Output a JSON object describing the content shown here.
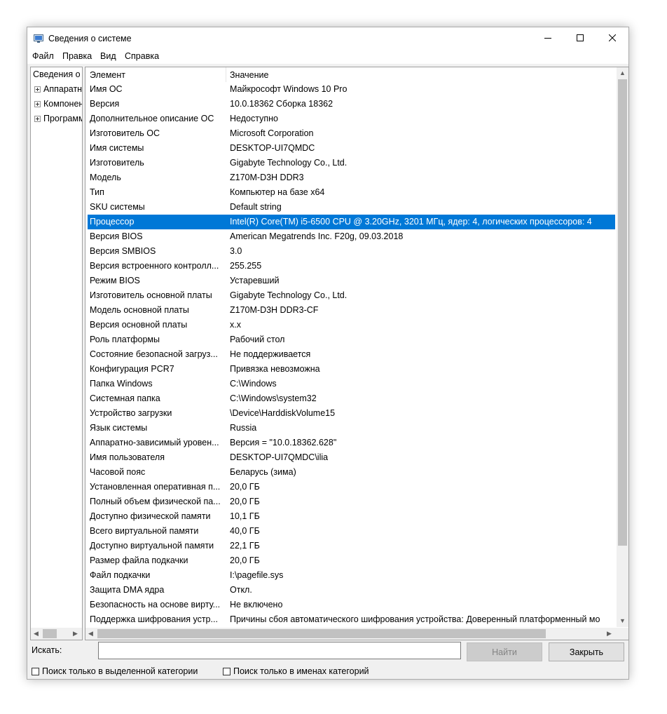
{
  "window": {
    "title": "Сведения о системе",
    "menu": [
      "Файл",
      "Правка",
      "Вид",
      "Справка"
    ]
  },
  "tree": {
    "root": "Сведения о системе",
    "children": [
      "Аппаратные ресурсы",
      "Компоненты",
      "Программная среда"
    ]
  },
  "list": {
    "columns": [
      "Элемент",
      "Значение"
    ],
    "selected_index": 9,
    "rows": [
      {
        "name": "Имя ОС",
        "value": "Майкрософт Windows 10 Pro"
      },
      {
        "name": "Версия",
        "value": "10.0.18362 Сборка 18362"
      },
      {
        "name": "Дополнительное описание ОС",
        "value": "Недоступно"
      },
      {
        "name": "Изготовитель ОС",
        "value": "Microsoft Corporation"
      },
      {
        "name": "Имя системы",
        "value": "DESKTOP-UI7QMDC"
      },
      {
        "name": "Изготовитель",
        "value": "Gigabyte Technology Co., Ltd."
      },
      {
        "name": "Модель",
        "value": "Z170M-D3H DDR3"
      },
      {
        "name": "Тип",
        "value": "Компьютер на базе x64"
      },
      {
        "name": "SKU системы",
        "value": "Default string"
      },
      {
        "name": "Процессор",
        "value": "Intel(R) Core(TM) i5-6500 CPU @ 3.20GHz, 3201 МГц, ядер: 4, логических процессоров: 4"
      },
      {
        "name": "Версия BIOS",
        "value": "American Megatrends Inc. F20g, 09.03.2018"
      },
      {
        "name": "Версия SMBIOS",
        "value": "3.0"
      },
      {
        "name": "Версия встроенного контролл...",
        "value": "255.255"
      },
      {
        "name": "Режим BIOS",
        "value": "Устаревший"
      },
      {
        "name": "Изготовитель основной платы",
        "value": "Gigabyte Technology Co., Ltd."
      },
      {
        "name": "Модель основной платы",
        "value": "Z170M-D3H DDR3-CF"
      },
      {
        "name": "Версия основной платы",
        "value": "x.x"
      },
      {
        "name": "Роль платформы",
        "value": "Рабочий стол"
      },
      {
        "name": "Состояние безопасной загруз...",
        "value": "Не поддерживается"
      },
      {
        "name": "Конфигурация PCR7",
        "value": "Привязка невозможна"
      },
      {
        "name": "Папка Windows",
        "value": "C:\\Windows"
      },
      {
        "name": "Системная папка",
        "value": "C:\\Windows\\system32"
      },
      {
        "name": "Устройство загрузки",
        "value": "\\Device\\HarddiskVolume15"
      },
      {
        "name": "Язык системы",
        "value": "Russia"
      },
      {
        "name": "Аппаратно-зависимый уровен...",
        "value": "Версия = \"10.0.18362.628\""
      },
      {
        "name": "Имя пользователя",
        "value": "DESKTOP-UI7QMDC\\ilia"
      },
      {
        "name": "Часовой пояс",
        "value": "Беларусь (зима)"
      },
      {
        "name": "Установленная оперативная п...",
        "value": "20,0 ГБ"
      },
      {
        "name": "Полный объем физической па...",
        "value": "20,0 ГБ"
      },
      {
        "name": "Доступно физической памяти",
        "value": "10,1 ГБ"
      },
      {
        "name": "Всего виртуальной памяти",
        "value": "40,0 ГБ"
      },
      {
        "name": "Доступно виртуальной памяти",
        "value": "22,1 ГБ"
      },
      {
        "name": "Размер файла подкачки",
        "value": "20,0 ГБ"
      },
      {
        "name": "Файл подкачки",
        "value": "I:\\pagefile.sys"
      },
      {
        "name": "Защита DMA ядра",
        "value": "Откл."
      },
      {
        "name": "Безопасность на основе вирту...",
        "value": "Не включено"
      },
      {
        "name": "Поддержка шифрования устр...",
        "value": "Причины сбоя автоматического шифрования устройства: Доверенный платформенный мо"
      }
    ]
  },
  "search": {
    "label": "Искать:",
    "value": "",
    "find_button": "Найти",
    "close_button": "Закрыть",
    "check_selected_category": "Поиск только в выделенной категории",
    "check_category_names": "Поиск только в именах категорий"
  },
  "colors": {
    "selection": "#0078d7",
    "window_bg": "#f0f0f0"
  }
}
